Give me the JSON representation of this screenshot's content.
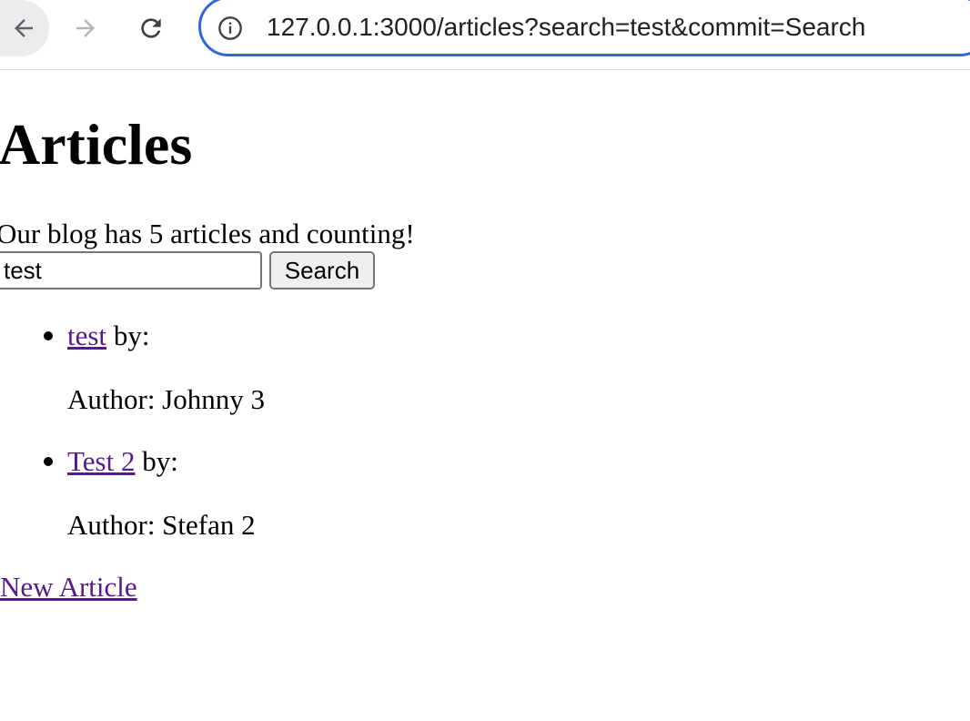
{
  "browser": {
    "url": "127.0.0.1:3000/articles?search=test&commit=Search",
    "icons": {
      "back": "arrow-left-icon",
      "forward": "arrow-right-icon",
      "reload": "reload-icon",
      "site_info": "info-circle-icon"
    },
    "colors": {
      "address_border": "#3367d6"
    }
  },
  "page": {
    "title": "Articles",
    "count_text": "Our blog has 5 articles and counting!",
    "search": {
      "value": "test",
      "button_label": "Search"
    },
    "articles": [
      {
        "title": "test",
        "by_text": " by:",
        "author_text": "Author: Johnny 3"
      },
      {
        "title": "Test 2",
        "by_text": " by:",
        "author_text": "Author: Stefan 2"
      }
    ],
    "new_article_label": "New Article",
    "colors": {
      "visited_link": "#551a8b"
    }
  }
}
